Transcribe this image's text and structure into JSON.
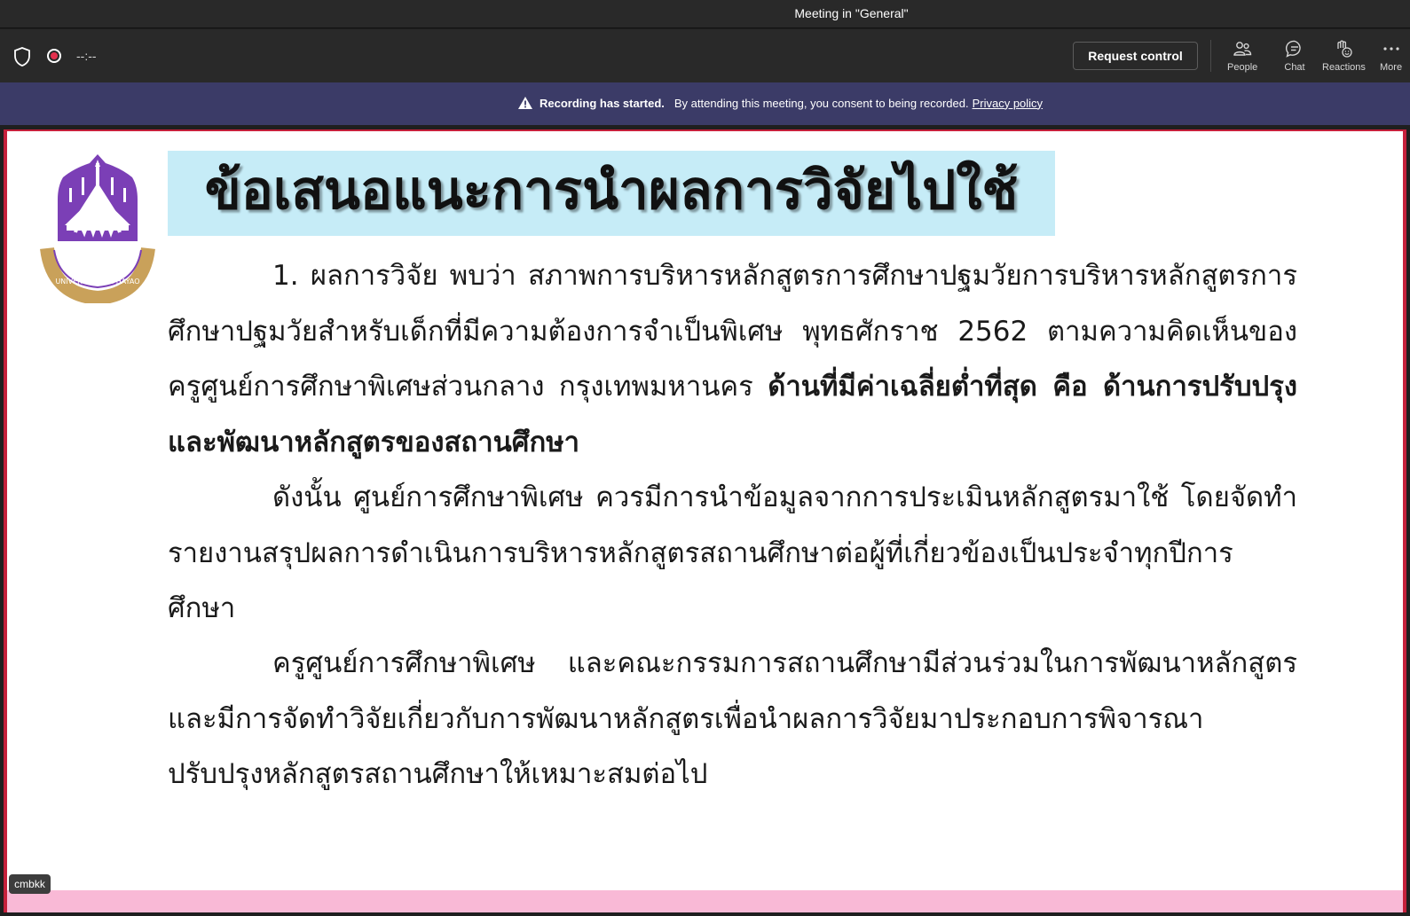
{
  "window": {
    "title": "Meeting in \"General\""
  },
  "toolbar": {
    "timer": "--:--",
    "request_control": "Request control",
    "people": "People",
    "chat": "Chat",
    "reactions": "Reactions",
    "more": "More"
  },
  "banner": {
    "strong": "Recording has started.",
    "text": "By attending this meeting, you consent to being recorded.",
    "link": "Privacy policy"
  },
  "slide": {
    "logo_text": "มหาวิทยาลัยพะเยา UNIVERSITY OF PHAYAO",
    "heading": "ข้อเสนอแนะการนำผลการวิจัยไปใช้",
    "p1_normal": "1. ผลการวิจัย พบว่า สภาพการบริหารหลักสูตรการศึกษาปฐมวัยการบริหารหลักสูตรการศึกษาปฐมวัยสำหรับเด็กที่มีความต้องการจำเป็นพิเศษ พุทธศักราช 2562 ตามความคิดเห็นของครูศูนย์การศึกษาพิเศษส่วนกลาง กรุงเทพมหานคร",
    "p1_bold": "ด้านที่มีค่าเฉลี่ยต่ำที่สุด คือ ด้านการปรับปรุงและพัฒนาหลักสูตรของสถานศึกษา",
    "p2": "ดังนั้น ศูนย์การศึกษาพิเศษ ควรมีการนำข้อมูลจากการประเมินหลักสูตรมาใช้ โดยจัดทำรายงานสรุปผลการดำเนินการบริหารหลักสูตรสถานศึกษาต่อผู้ที่เกี่ยวข้องเป็นประจำทุกปีการศึกษา",
    "p3": "ครูศูนย์การศึกษาพิเศษ และคณะกรรมการสถานศึกษามีส่วนร่วมในการพัฒนาหลักสูตร และมีการจัดทำวิจัยเกี่ยวกับการพัฒนาหลักสูตรเพื่อนำผลการวิจัยมาประกอบการพิจารณาปรับปรุงหลักสูตรสถานศึกษาให้เหมาะสมต่อไป"
  },
  "presenter": {
    "name": "cmbkk"
  },
  "colors": {
    "title_bar": "#292929",
    "banner": "#3b3b67",
    "slide_frame": "#c5203b",
    "heading_bg": "#c6ecf7",
    "logo_purple": "#7b3fb6",
    "logo_gold": "#c9a15a",
    "bottom_bar": "#f9b9d6"
  },
  "icons": {
    "shield": "shield-icon",
    "record": "record-icon",
    "people": "people-icon",
    "chat": "chat-icon",
    "reactions": "reactions-icon",
    "more": "more-icon",
    "warning": "warning-icon"
  }
}
